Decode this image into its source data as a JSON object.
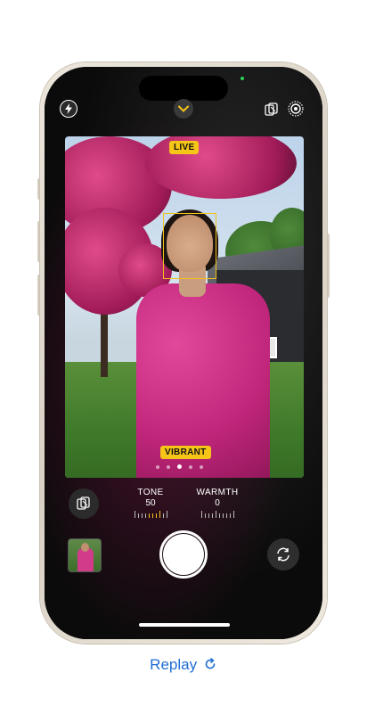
{
  "camera": {
    "live_badge": "LIVE",
    "style_badge": "VIBRANT",
    "tone": {
      "label": "TONE",
      "value": "50"
    },
    "warmth": {
      "label": "WARMTH",
      "value": "0"
    },
    "style_dots": {
      "count": 5,
      "active_index": 2
    }
  },
  "icons": {
    "flash": "flash-icon",
    "chevron": "chevron-up-icon",
    "styles": "photographic-styles-icon",
    "live": "live-photo-icon",
    "flip": "camera-flip-icon",
    "shutter": "shutter-button",
    "replay": "replay-icon"
  },
  "colors": {
    "badge": "#f5c518",
    "link": "#1f6ed4",
    "frame": "#e3dcd0"
  },
  "footer": {
    "replay_label": "Replay"
  }
}
